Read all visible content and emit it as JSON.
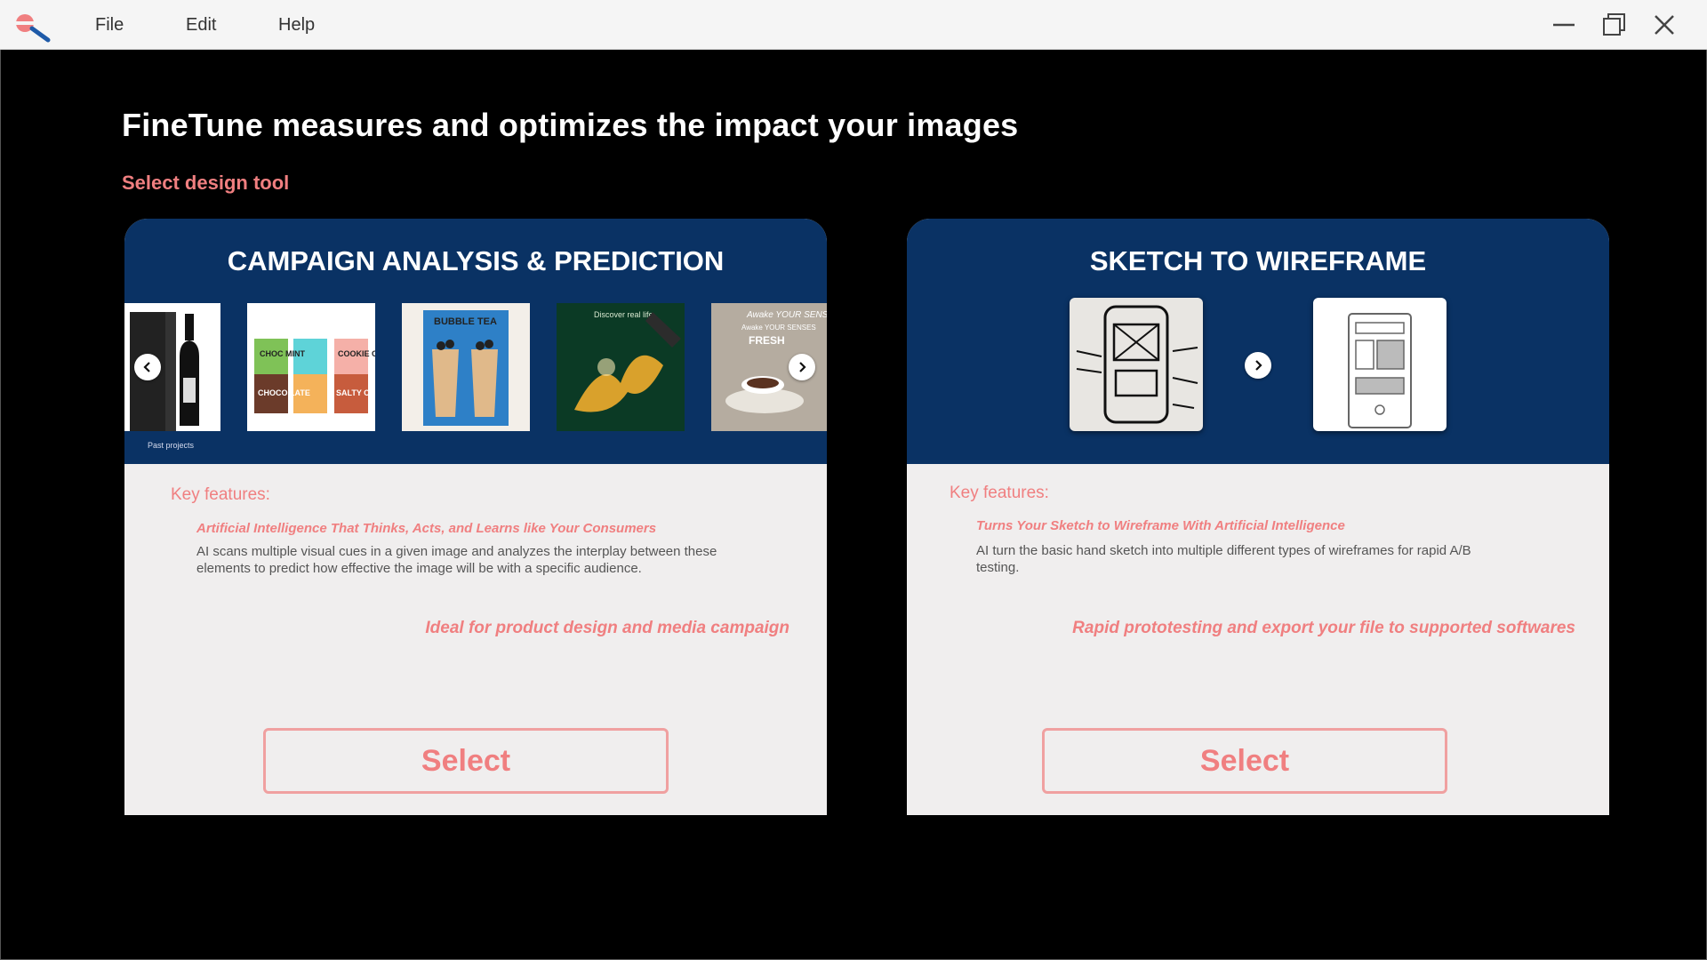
{
  "menu": {
    "file": "File",
    "edit": "Edit",
    "help": "Help"
  },
  "page": {
    "headline": "FineTune measures and optimizes the impact your images",
    "subhead": "Select design tool"
  },
  "cards": [
    {
      "title": "CAMPAIGN ANALYSIS & PREDICTION",
      "caption": "Past projects",
      "thumbnail_text": [
        "CHOC MINT",
        "COOKIE CREAM",
        "CHOCO LATE",
        "SALTY CARAM",
        "BUBBLE TEA",
        "Discover real life",
        "Awake YOUR SENSES",
        "FRESH"
      ],
      "key_features_title": "Key features:",
      "feature_sub": "Artificial Intelligence That Thinks, Acts, and Learns like Your Consumers",
      "feature_desc": "AI scans multiple visual cues in a given image and analyzes the interplay between these elements to predict how effective the image will be with a specific audience.",
      "ideal": "Ideal for product design and media campaign",
      "button": "Select"
    },
    {
      "title": "SKETCH TO WIREFRAME",
      "key_features_title": "Key features:",
      "feature_sub": "Turns Your Sketch to Wireframe With Artificial Intelligence",
      "feature_desc": "AI turn the basic hand sketch into multiple different types of wireframes for rapid A/B testing.",
      "ideal": "Rapid prototesting and export your file to supported softwares",
      "button": "Select"
    }
  ],
  "colors": {
    "accent": "#f07f80",
    "card_header": "#0a3264",
    "card_body": "#f0eeee",
    "background": "#000000"
  },
  "icons": [
    "app-logo-icon",
    "minimize-icon",
    "restore-icon",
    "close-icon",
    "chevron-left-icon",
    "chevron-right-icon"
  ]
}
